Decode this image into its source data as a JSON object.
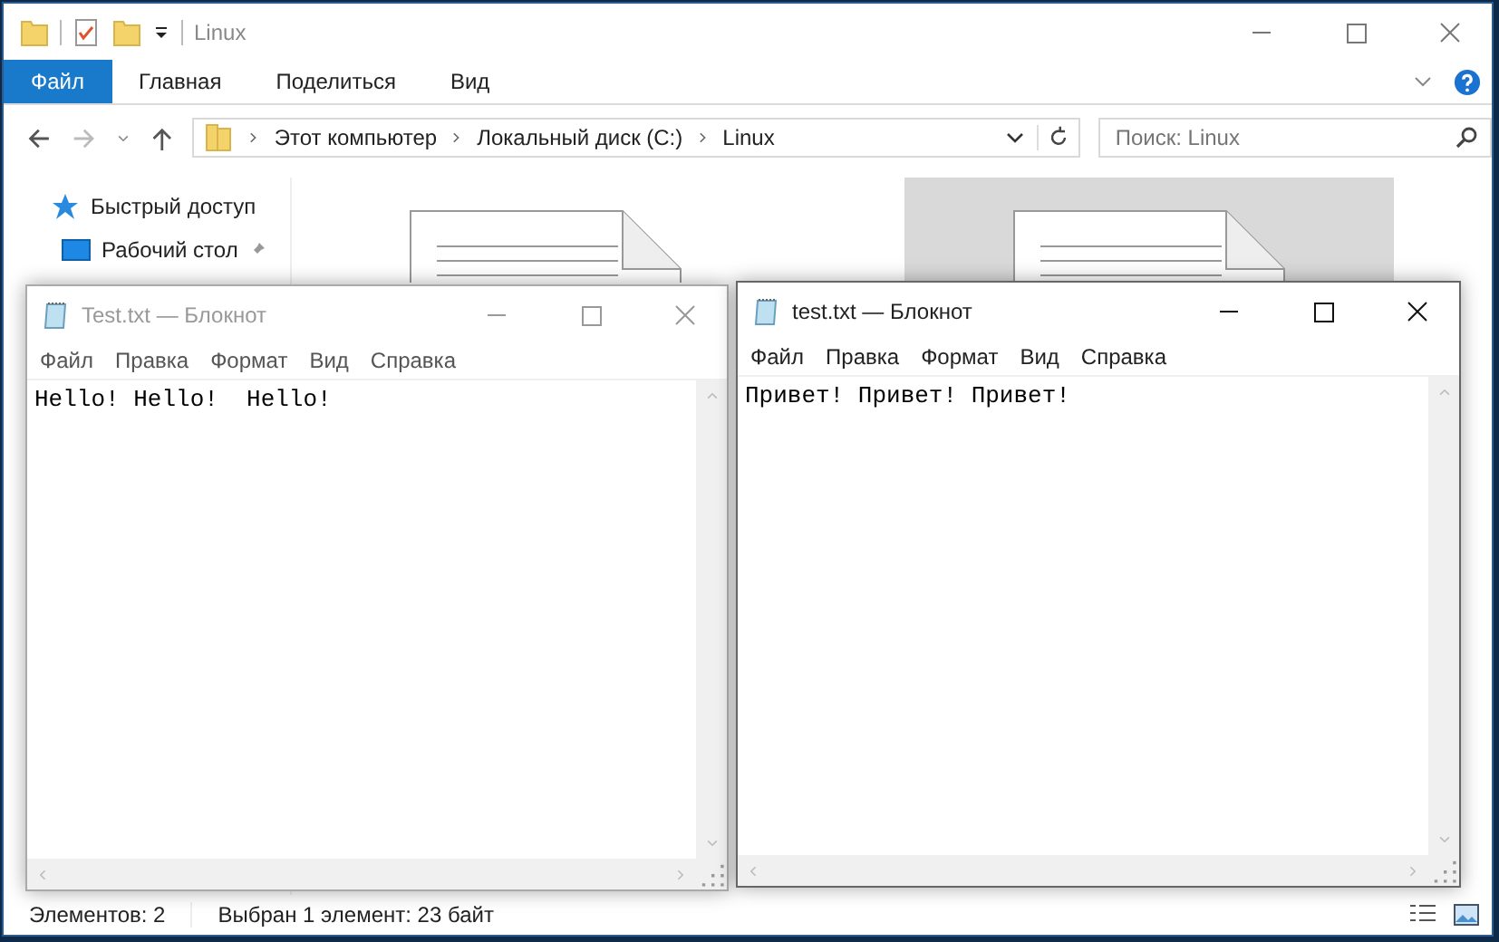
{
  "explorer": {
    "title": "Linux",
    "ribbon_tabs": [
      {
        "label": "Файл",
        "selected": true
      },
      {
        "label": "Главная",
        "selected": false
      },
      {
        "label": "Поделиться",
        "selected": false
      },
      {
        "label": "Вид",
        "selected": false
      }
    ],
    "breadcrumb": [
      "Этот компьютер",
      "Локальный диск (C:)",
      "Linux"
    ],
    "search": {
      "placeholder": "Поиск: Linux"
    },
    "nav_items": [
      {
        "label": "Быстрый доступ",
        "kind": "quick"
      },
      {
        "label": "Рабочий стол",
        "kind": "desktop"
      }
    ],
    "files": [
      {
        "selected": false
      },
      {
        "selected": true
      }
    ],
    "status": {
      "count": "Элементов: 2",
      "selection": "Выбран 1 элемент: 23 байт"
    }
  },
  "notepads": [
    {
      "title": "Test.txt — Блокнот",
      "active": false,
      "menu": [
        "Файл",
        "Правка",
        "Формат",
        "Вид",
        "Справка"
      ],
      "text": "Hello! Hello!  Hello!"
    },
    {
      "title": "test.txt — Блокнот",
      "active": true,
      "menu": [
        "Файл",
        "Правка",
        "Формат",
        "Вид",
        "Справка"
      ],
      "text": "Привет! Привет! Привет!"
    }
  ]
}
